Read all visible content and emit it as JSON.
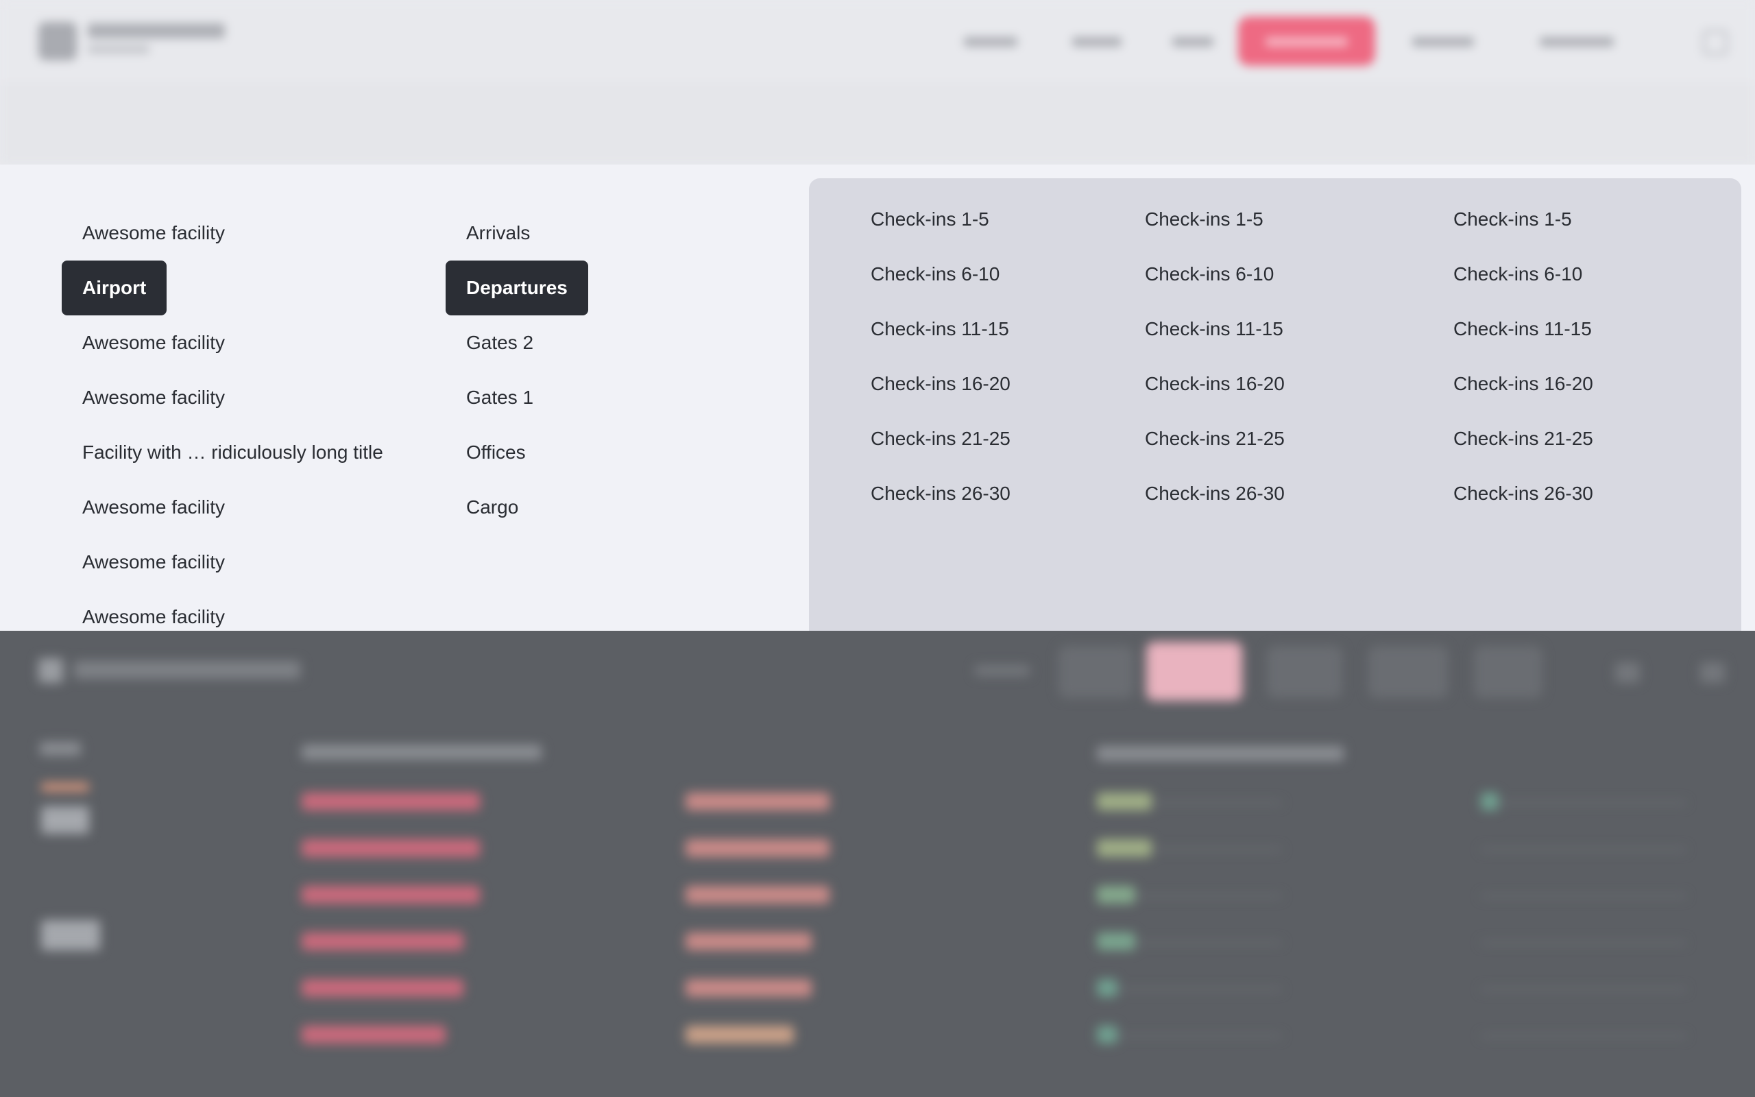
{
  "facilities": [
    {
      "label": "Awesome facility",
      "selected": false
    },
    {
      "label": "Airport",
      "selected": true
    },
    {
      "label": "Awesome facility",
      "selected": false
    },
    {
      "label": "Awesome facility",
      "selected": false
    },
    {
      "label": "Facility with … ridiculously long title",
      "selected": false
    },
    {
      "label": "Awesome facility",
      "selected": false
    },
    {
      "label": "Awesome facility",
      "selected": false
    },
    {
      "label": "Awesome facility",
      "selected": false
    }
  ],
  "zones": [
    {
      "label": "Arrivals",
      "selected": false
    },
    {
      "label": "Departures",
      "selected": true
    },
    {
      "label": "Gates 2",
      "selected": false
    },
    {
      "label": "Gates 1",
      "selected": false
    },
    {
      "label": "Offices",
      "selected": false
    },
    {
      "label": "Cargo",
      "selected": false
    }
  ],
  "checkin_columns": [
    [
      "Check-ins 1-5",
      "Check-ins 6-10",
      "Check-ins 11-15",
      "Check-ins 16-20",
      "Check-ins 21-25",
      "Check-ins 26-30"
    ],
    [
      "Check-ins 1-5",
      "Check-ins 6-10",
      "Check-ins 11-15",
      "Check-ins 16-20",
      "Check-ins 21-25",
      "Check-ins 26-30"
    ],
    [
      "Check-ins 1-5",
      "Check-ins 6-10",
      "Check-ins 11-15",
      "Check-ins 16-20",
      "Check-ins 21-25",
      "Check-ins 26-30"
    ]
  ],
  "colors": {
    "accent": "#ee6a83",
    "selected_bg": "#2b2e35",
    "panel_bg": "#f1f2f7",
    "checkin_panel_bg": "#d8d9e1",
    "overlay": "#5c5f64"
  }
}
